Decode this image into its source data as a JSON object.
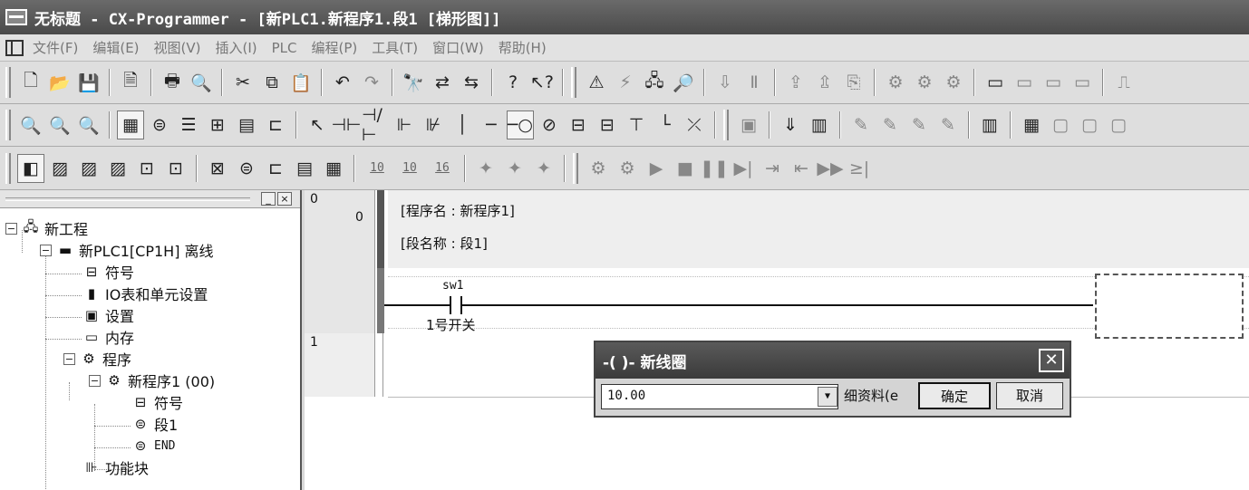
{
  "window": {
    "title": "无标题 - CX-Programmer - [新PLC1.新程序1.段1 [梯形图]]"
  },
  "menu": [
    "文件(F)",
    "编辑(E)",
    "视图(V)",
    "插入(I)",
    "PLC",
    "编程(P)",
    "工具(T)",
    "窗口(W)",
    "帮助(H)"
  ],
  "toolbar3": {
    "addr_10": "10",
    "addr_10b": "10",
    "addr_16": "16"
  },
  "tree": {
    "project": "新工程",
    "plc": "新PLC1[CP1H] 离线",
    "symbols": "符号",
    "io_table": "IO表和单元设置",
    "settings": "设置",
    "memory": "内存",
    "programs": "程序",
    "program1": "新程序1 (00)",
    "program1_symbols": "符号",
    "section1": "段1",
    "end": "END",
    "function_blocks": "功能块"
  },
  "ladder": {
    "rung0_num": "0",
    "rung0_step": "0",
    "program_name": "[程序名 : 新程序1]",
    "section_name": "[段名称 : 段1]",
    "contact_operand": "sw1",
    "contact_comment": "1号开关",
    "rung1_num": "1"
  },
  "dialog": {
    "title": "-( )- 新线圈",
    "input_value": "10.00",
    "detail_label": "细资料(e",
    "ok_label": "确定",
    "cancel_label": "取消"
  }
}
